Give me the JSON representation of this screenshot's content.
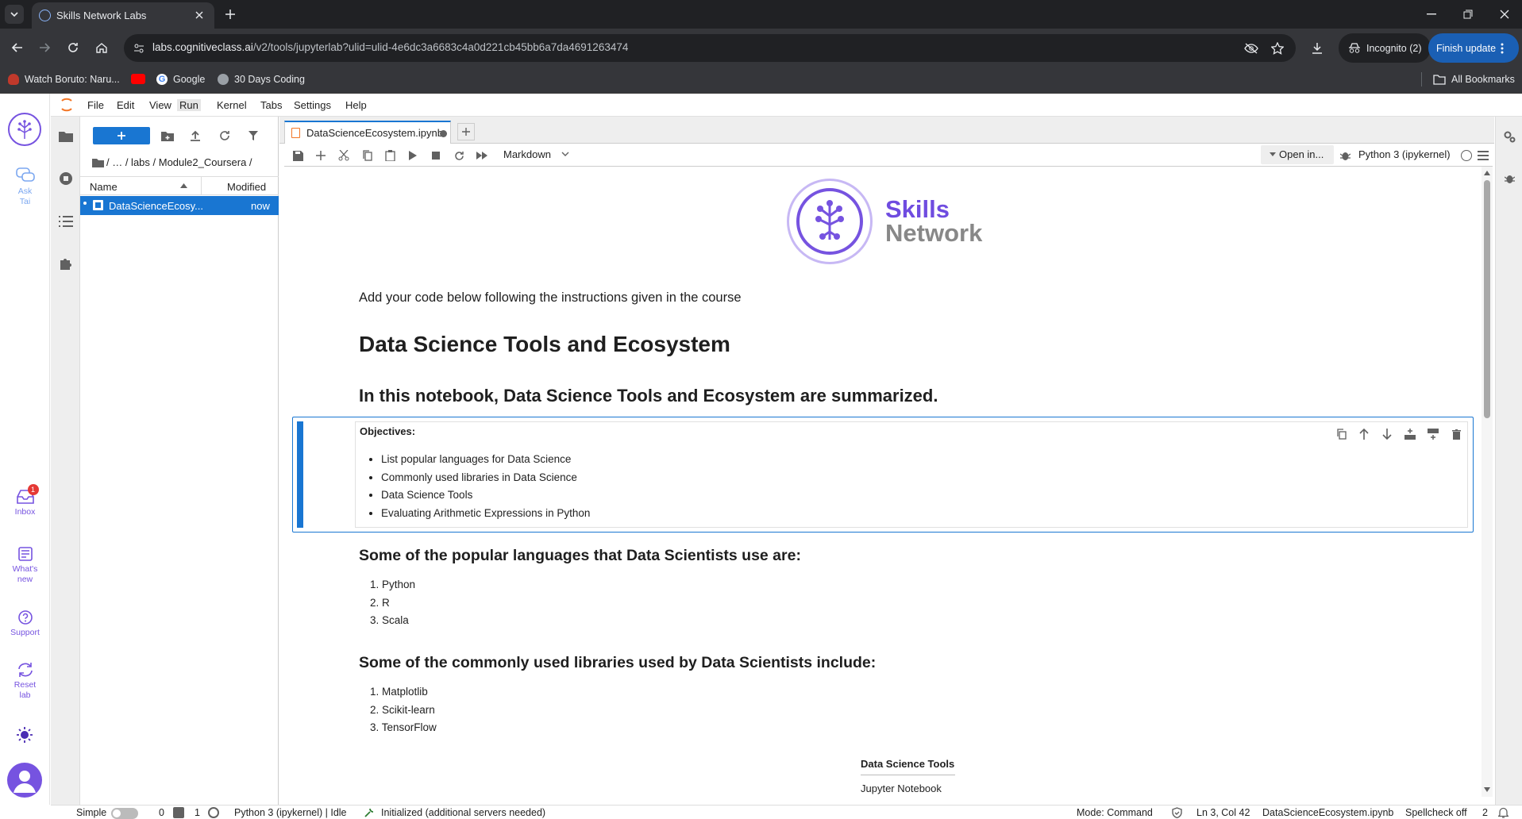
{
  "browser": {
    "tab_title": "Skills Network Labs",
    "url_host": "labs.cognitiveclass.ai",
    "url_path": "/v2/tools/jupyterlab?ulid=ulid-4e6dc3a6683c4a0d221cb45bb6a7da4691263474",
    "incognito_label": "Incognito (2)",
    "finish_update_label": "Finish update",
    "bookmarks": [
      "Watch Boruto: Naru...",
      "",
      "Google",
      "30 Days Coding"
    ],
    "all_bookmarks_label": "All Bookmarks"
  },
  "rail": {
    "items": [
      {
        "label": "Ask\nTai"
      },
      {
        "label": "Inbox",
        "badge": "1"
      },
      {
        "label": "What's\nnew"
      },
      {
        "label": "Support"
      },
      {
        "label": "Reset\nlab"
      }
    ]
  },
  "menubar": [
    "File",
    "Edit",
    "View",
    "Run",
    "Kernel",
    "Tabs",
    "Settings",
    "Help"
  ],
  "filebrowser": {
    "breadcrumb": "/   …   / labs / Module2_Coursera /",
    "col_name": "Name",
    "col_modified": "Modified",
    "files": [
      {
        "name": "DataScienceEcosy...",
        "modified": "now"
      }
    ]
  },
  "notebook": {
    "tab_label": "DataScienceEcosystem.ipynb",
    "cell_type": "Markdown",
    "open_in": "Open in...",
    "kernel": "Python 3 (ipykernel)",
    "logo_line1": "Skills",
    "logo_line2": "Network",
    "intro": "Add your code below following the instructions given in the course",
    "title": "Data Science Tools and Ecosystem",
    "summary": "In this notebook, Data Science Tools and Ecosystem are summarized.",
    "objectives_heading": "Objectives:",
    "objectives": [
      "List popular languages for Data Science",
      "Commonly used libraries in Data Science",
      "Data Science Tools",
      "Evaluating Arithmetic Expressions in Python"
    ],
    "languages_heading": "Some of the popular languages that Data Scientists use are:",
    "languages": [
      "1. Python",
      "2. R",
      "3. Scala"
    ],
    "libraries_heading": "Some of the commonly used libraries used by Data Scientists include:",
    "libraries": [
      "1. Matplotlib",
      "2. Scikit-learn",
      "3. TensorFlow"
    ],
    "tools_table_header": "Data Science Tools",
    "tools_table_rows": [
      "Jupyter Notebook"
    ]
  },
  "statusbar": {
    "simple": "Simple",
    "count_a": "0",
    "count_b": "1",
    "kernel_status": "Python 3 (ipykernel) | Idle",
    "lsp_status": "Initialized (additional servers needed)",
    "mode": "Mode: Command",
    "cursor": "Ln 3, Col 42",
    "file": "DataScienceEcosystem.ipynb",
    "spellcheck": "Spellcheck off",
    "notifications": "2"
  }
}
